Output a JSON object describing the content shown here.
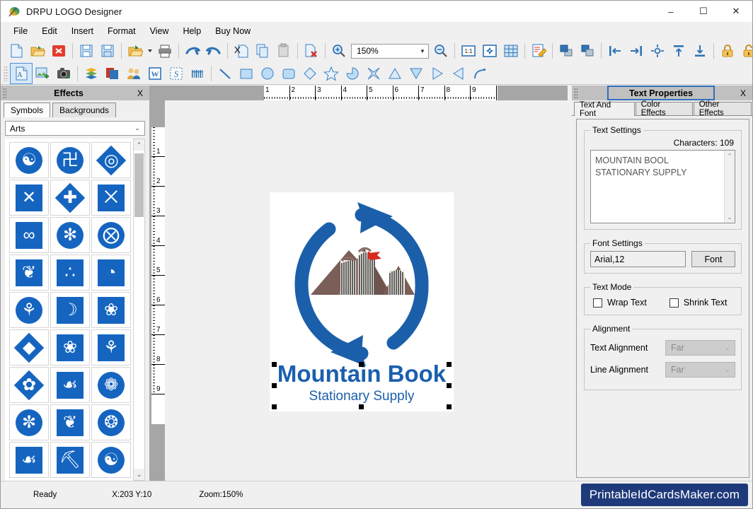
{
  "window": {
    "title": "DRPU LOGO Designer",
    "icon": "app-logo-icon",
    "minimize": "–",
    "maximize": "☐",
    "close": "✕"
  },
  "menu": {
    "items": [
      {
        "label": "File"
      },
      {
        "label": "Edit"
      },
      {
        "label": "Insert"
      },
      {
        "label": "Format"
      },
      {
        "label": "View"
      },
      {
        "label": "Help"
      },
      {
        "label": "Buy Now"
      }
    ]
  },
  "toolbar_top": {
    "zoom_value": "150%",
    "items": [
      {
        "name": "new-icon"
      },
      {
        "name": "open-icon"
      },
      {
        "name": "close-document-icon"
      },
      {
        "name": "save-icon"
      },
      {
        "name": "save-as-icon"
      },
      {
        "name": "export-icon"
      },
      {
        "name": "export-dropdown-icon"
      },
      {
        "name": "print-icon"
      },
      {
        "name": "undo-icon"
      },
      {
        "name": "redo-icon"
      },
      {
        "name": "cut-icon"
      },
      {
        "name": "copy-icon"
      },
      {
        "name": "paste-icon"
      },
      {
        "name": "delete-icon"
      },
      {
        "name": "zoom-in-icon"
      },
      {
        "name": "zoom-out-icon"
      },
      {
        "name": "actual-size-icon"
      },
      {
        "name": "fit-to-window-icon"
      },
      {
        "name": "grid-icon"
      },
      {
        "name": "edit-properties-icon"
      },
      {
        "name": "bring-to-front-icon"
      },
      {
        "name": "send-to-back-icon"
      },
      {
        "name": "align-left-icon"
      },
      {
        "name": "align-right-icon"
      },
      {
        "name": "align-center-icon"
      },
      {
        "name": "align-top-icon"
      },
      {
        "name": "align-bottom-icon"
      },
      {
        "name": "lock-icon"
      },
      {
        "name": "unlock-icon"
      }
    ]
  },
  "toolbar_shapes": {
    "items": [
      {
        "name": "add-text-icon",
        "active": true
      },
      {
        "name": "add-image-icon"
      },
      {
        "name": "capture-image-icon"
      },
      {
        "name": "layers-icon"
      },
      {
        "name": "background-icon"
      },
      {
        "name": "signature-icon"
      },
      {
        "name": "word-art-icon"
      },
      {
        "name": "style-text-icon"
      },
      {
        "name": "barcode-icon"
      },
      {
        "name": "line-shape-icon"
      },
      {
        "name": "rectangle-shape-icon"
      },
      {
        "name": "ellipse-shape-icon"
      },
      {
        "name": "rounded-rectangle-shape-icon"
      },
      {
        "name": "diamond-shape-icon"
      },
      {
        "name": "star-shape-icon"
      },
      {
        "name": "pie-shape-icon"
      },
      {
        "name": "four-point-star-shape-icon"
      },
      {
        "name": "triangle-shape-icon"
      },
      {
        "name": "inverted-triangle-shape-icon"
      },
      {
        "name": "right-triangle-shape-icon"
      },
      {
        "name": "left-triangle-shape-icon"
      },
      {
        "name": "arc-shape-icon"
      }
    ]
  },
  "effects_panel": {
    "title": "Effects",
    "close_label": "X",
    "tabs": [
      {
        "label": "Symbols",
        "active": true
      },
      {
        "label": "Backgrounds",
        "active": false
      }
    ],
    "category": {
      "selected": "Arts",
      "arrow": "⌄"
    },
    "scroll": {
      "up": "⌃",
      "down": "⌄"
    },
    "symbols": [
      {
        "glyph": "☯",
        "shape": "circ"
      },
      {
        "glyph": "卍",
        "shape": "circ"
      },
      {
        "glyph": "◎",
        "shape": "diamond"
      },
      {
        "glyph": "✕",
        "shape": "sq"
      },
      {
        "glyph": "✚",
        "shape": "diamond"
      },
      {
        "glyph": "⨉",
        "shape": "sq"
      },
      {
        "glyph": "∞",
        "shape": "sq"
      },
      {
        "glyph": "✻",
        "shape": "circ"
      },
      {
        "glyph": "⨂",
        "shape": "circ"
      },
      {
        "glyph": "❦",
        "shape": "sq"
      },
      {
        "glyph": "∴",
        "shape": "sq"
      },
      {
        "glyph": "◔",
        "shape": "sq"
      },
      {
        "glyph": "⚘",
        "shape": "circ"
      },
      {
        "glyph": "☽",
        "shape": "sq"
      },
      {
        "glyph": "❀",
        "shape": "sq"
      },
      {
        "glyph": "◆",
        "shape": "diamond"
      },
      {
        "glyph": "❀",
        "shape": "sq"
      },
      {
        "glyph": "⚘",
        "shape": "sq"
      },
      {
        "glyph": "✿",
        "shape": "diamond"
      },
      {
        "glyph": "☙",
        "shape": "sq"
      },
      {
        "glyph": "❁",
        "shape": "circ"
      },
      {
        "glyph": "✼",
        "shape": "circ"
      },
      {
        "glyph": "❦",
        "shape": "sq"
      },
      {
        "glyph": "❂",
        "shape": "circ"
      },
      {
        "glyph": "☙",
        "shape": "sq"
      },
      {
        "glyph": "⛏",
        "shape": "sq"
      },
      {
        "glyph": "☯",
        "shape": "circ"
      }
    ]
  },
  "rulers": {
    "horizontal": [
      "1",
      "2",
      "3",
      "4",
      "5",
      "6",
      "7",
      "8",
      "9"
    ],
    "vertical": [
      "1",
      "2",
      "3",
      "4",
      "5",
      "6",
      "7",
      "8",
      "9"
    ]
  },
  "canvas": {
    "logo": {
      "title_line1": "Mountain Book",
      "title_line2": "Stationary Supply",
      "title_color": "#1a5fad",
      "ring_color": "#1b5faa",
      "mountain_color": "#7b5e58",
      "book_page_color": "#f2efe9",
      "flag_color": "#d62a20"
    }
  },
  "text_properties": {
    "title": "Text Properties",
    "close_label": "X",
    "tabs": [
      {
        "label": "Text And Font",
        "active": true
      },
      {
        "label": "Color Effects",
        "active": false
      },
      {
        "label": "Other Effects",
        "active": false
      }
    ],
    "text_settings": {
      "legend": "Text Settings",
      "char_count_label": "Characters: 109",
      "value": "MOUNTAIN BOOL STATIONARY SUPPLY",
      "scroll_up": "⌃",
      "scroll_down": "⌄"
    },
    "font_settings": {
      "legend": "Font Settings",
      "value": "Arial,12",
      "button_label": "Font"
    },
    "text_mode": {
      "legend": "Text Mode",
      "wrap_label": "Wrap Text",
      "wrap_checked": false,
      "shrink_label": "Shrink Text",
      "shrink_checked": false
    },
    "alignment": {
      "legend": "Alignment",
      "text_alignment_label": "Text Alignment",
      "text_alignment_value": "Far",
      "line_alignment_label": "Line Alignment",
      "line_alignment_value": "Far",
      "arrow": "⌄"
    }
  },
  "statusbar": {
    "ready": "Ready",
    "coords": "X:203  Y:10",
    "zoom": "Zoom:150%",
    "brand": "PrintableIdCardsMaker.com",
    "brand_color": "#1f3a7a"
  }
}
